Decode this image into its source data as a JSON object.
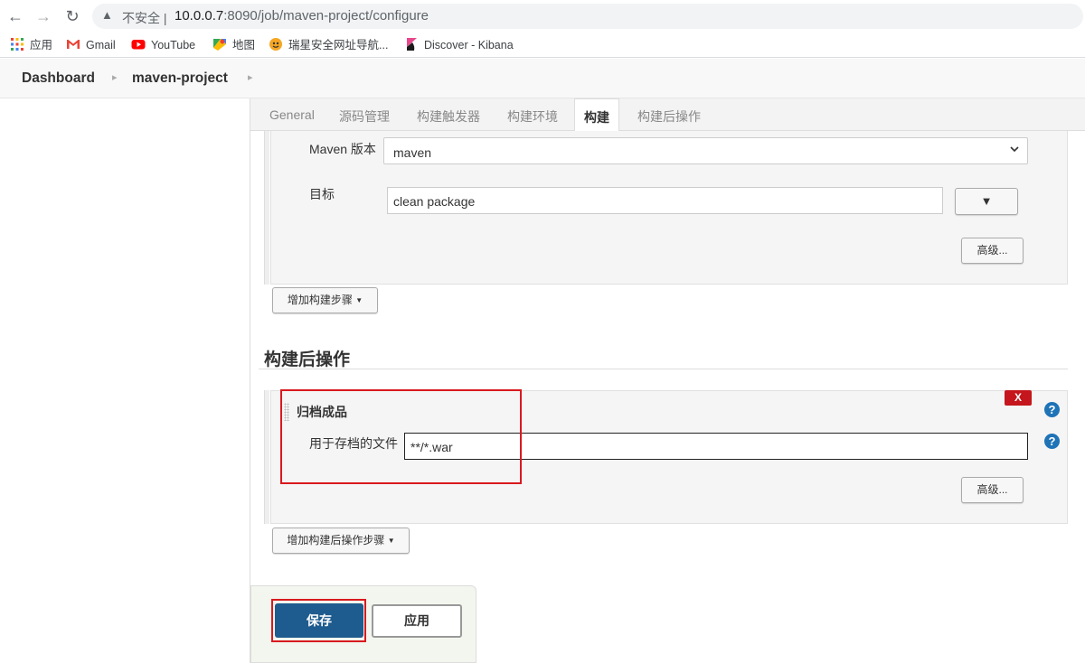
{
  "browser": {
    "insecure_label": "不安全",
    "url_host": "10.0.0.7",
    "url_path": ":8090/job/maven-project/configure",
    "bookmarks": [
      {
        "label": "应用",
        "icon": "apps-grid-icon"
      },
      {
        "label": "Gmail",
        "icon": "gmail-icon"
      },
      {
        "label": "YouTube",
        "icon": "youtube-icon"
      },
      {
        "label": "地图",
        "icon": "maps-icon"
      },
      {
        "label": "瑞星安全网址导航...",
        "icon": "rising-icon"
      },
      {
        "label": "Discover - Kibana",
        "icon": "kibana-icon"
      }
    ]
  },
  "breadcrumb": {
    "items": [
      "Dashboard",
      "maven-project"
    ]
  },
  "tabs": [
    {
      "label": "General",
      "active": false
    },
    {
      "label": "源码管理",
      "active": false
    },
    {
      "label": "构建触发器",
      "active": false
    },
    {
      "label": "构建环境",
      "active": false
    },
    {
      "label": "构建",
      "active": true
    },
    {
      "label": "构建后操作",
      "active": false
    }
  ],
  "build": {
    "maven_version_label": "Maven 版本",
    "maven_version_value": "maven",
    "goals_label": "目标",
    "goals_value": "clean package",
    "expand_glyph": "▼",
    "advanced_label": "高级...",
    "add_step_label": "增加构建步骤"
  },
  "post_build": {
    "section_title": "构建后操作",
    "step_title": "归档成品",
    "delete_label": "X",
    "files_label": "用于存档的文件",
    "files_value": "**/*.war",
    "advanced_label": "高级...",
    "add_step_label": "增加构建后操作步骤",
    "help_glyph": "?"
  },
  "footer": {
    "save_label": "保存",
    "apply_label": "应用"
  },
  "colors": {
    "save_blue": "#1e5b8e",
    "highlight_red": "#d9191f",
    "help_blue": "#1f73b7"
  }
}
